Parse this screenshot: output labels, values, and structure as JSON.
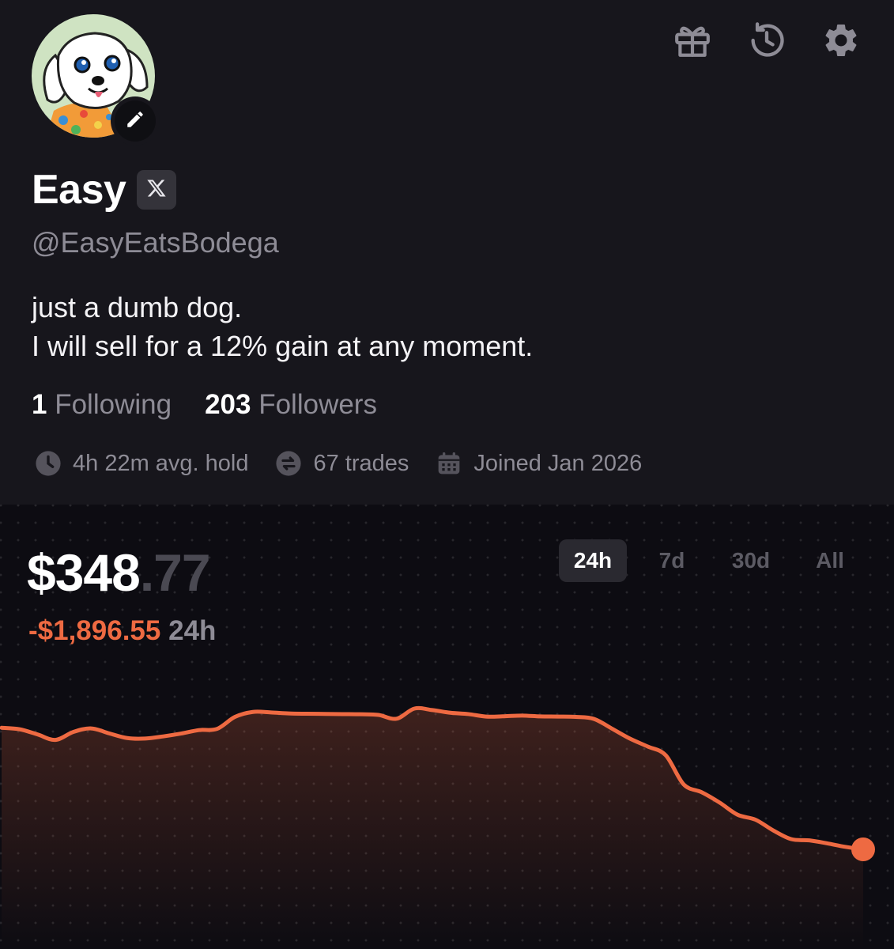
{
  "profile": {
    "name": "Easy",
    "handle": "@EasyEatsBodega",
    "bio_line1": "just a dumb dog.",
    "bio_line2": "I will sell for a 12% gain at any moment.",
    "following_count": "1",
    "following_label": "Following",
    "followers_count": "203",
    "followers_label": "Followers",
    "avg_hold": "4h 22m avg. hold",
    "trades": "67 trades",
    "joined": "Joined Jan 2026"
  },
  "icons": [
    "gift-icon",
    "history-icon",
    "gear-icon",
    "pencil-icon",
    "x-logo-icon",
    "clock-icon",
    "swap-icon",
    "calendar-icon"
  ],
  "portfolio": {
    "value_whole": "$348",
    "value_cents": ".77",
    "change": "-$1,896.55",
    "change_period": "24h",
    "tabs": [
      "24h",
      "7d",
      "30d",
      "All"
    ],
    "active_tab": "24h"
  },
  "colors": {
    "accent": "#ee6a42",
    "background": "#17161c",
    "chart_background": "#0d0c12"
  },
  "chart_data": {
    "type": "line",
    "x": [
      0,
      0.5,
      1,
      1.5,
      2,
      2.5,
      3,
      3.5,
      4,
      4.5,
      5,
      5.5,
      6,
      6.5,
      7,
      7.5,
      8,
      8.5,
      9,
      9.5,
      10,
      10.5,
      11,
      11.5,
      12,
      12.5,
      13,
      13.5,
      14,
      14.5,
      15,
      15.5,
      16,
      16.5,
      17,
      17.5,
      18,
      18.5,
      19,
      19.5,
      20,
      20.5,
      21,
      21.5,
      22,
      22.5,
      23,
      23.5,
      24
    ],
    "values": [
      3235,
      3226,
      3195,
      3162,
      3210,
      3231,
      3201,
      3173,
      3170,
      3183,
      3200,
      3221,
      3228,
      3300,
      3330,
      3327,
      3321,
      3319,
      3318,
      3317,
      3316,
      3312,
      3289,
      3350,
      3341,
      3325,
      3317,
      3302,
      3304,
      3308,
      3303,
      3302,
      3300,
      3288,
      3230,
      3170,
      3122,
      3070,
      2895,
      2848,
      2786,
      2713,
      2683,
      2618,
      2566,
      2559,
      2541,
      2520,
      2505
    ],
    "xlabel": "",
    "ylabel": "",
    "grid": true,
    "legend": "none"
  }
}
